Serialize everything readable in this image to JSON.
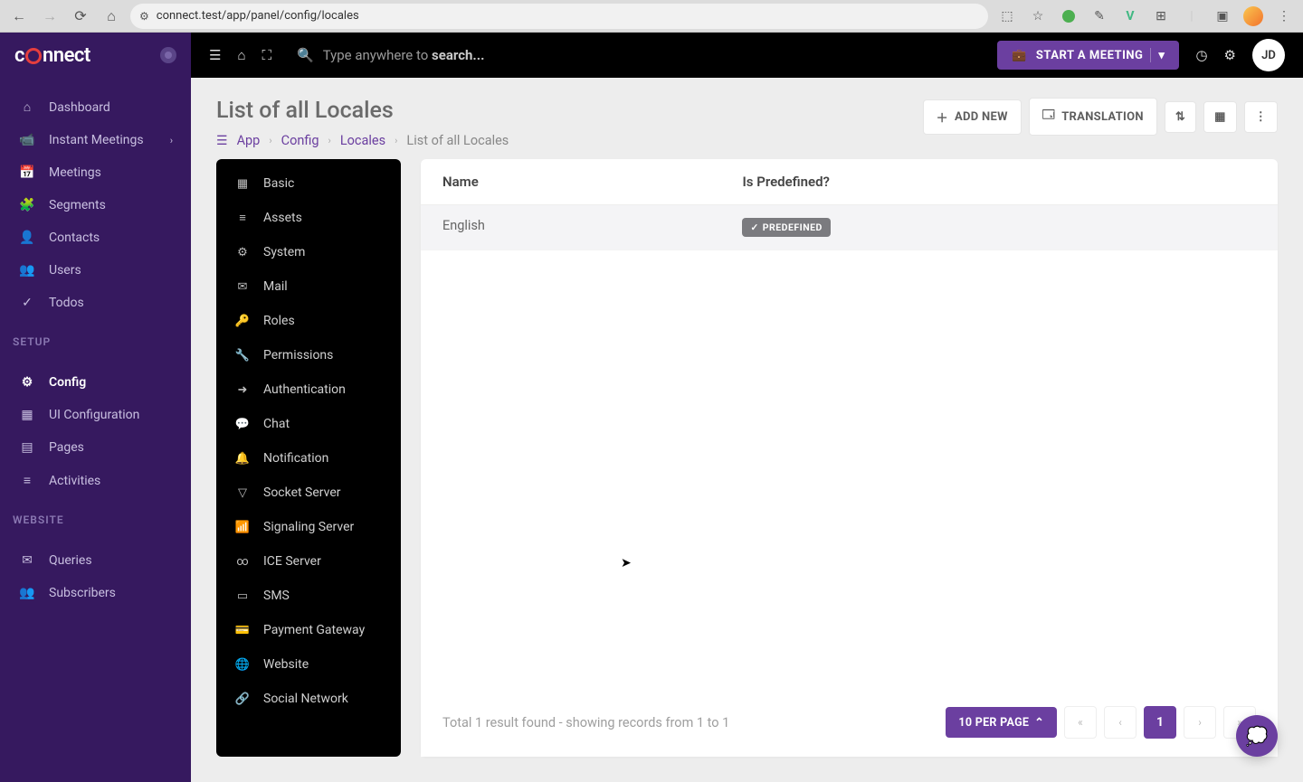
{
  "browser": {
    "url": "connect.test/app/panel/config/locales"
  },
  "brand": {
    "prefix": "c",
    "suffix": "nnect"
  },
  "topbar": {
    "search_placeholder_pre": "Type anywhere to ",
    "search_placeholder_bold": "search...",
    "meeting_btn": "START A MEETING",
    "avatar": "JD"
  },
  "sidebar": {
    "items": [
      {
        "label": "Dashboard",
        "icon": "⌂",
        "name": "dashboard"
      },
      {
        "label": "Instant Meetings",
        "icon": "📹",
        "name": "instant-meetings",
        "has_children": true
      },
      {
        "label": "Meetings",
        "icon": "📅",
        "name": "meetings"
      },
      {
        "label": "Segments",
        "icon": "🧩",
        "name": "segments"
      },
      {
        "label": "Contacts",
        "icon": "👤",
        "name": "contacts"
      },
      {
        "label": "Users",
        "icon": "👥",
        "name": "users"
      },
      {
        "label": "Todos",
        "icon": "✓",
        "name": "todos"
      }
    ],
    "section_setup": "SETUP",
    "setup_items": [
      {
        "label": "Config",
        "icon": "⚙",
        "name": "config",
        "active": true
      },
      {
        "label": "UI Configuration",
        "icon": "▦",
        "name": "ui-configuration"
      },
      {
        "label": "Pages",
        "icon": "▤",
        "name": "pages"
      },
      {
        "label": "Activities",
        "icon": "≡",
        "name": "activities"
      }
    ],
    "section_website": "WEBSITE",
    "website_items": [
      {
        "label": "Queries",
        "icon": "✉",
        "name": "queries"
      },
      {
        "label": "Subscribers",
        "icon": "👥",
        "name": "subscribers"
      }
    ]
  },
  "page": {
    "title": "List of all Locales",
    "breadcrumbs": {
      "app": "App",
      "config": "Config",
      "locales": "Locales",
      "current": "List of all Locales"
    },
    "actions": {
      "add_new": "ADD NEW",
      "translation": "TRANSLATION"
    }
  },
  "config_nav": [
    {
      "label": "Basic",
      "icon": "▦",
      "name": "basic"
    },
    {
      "label": "Assets",
      "icon": "≡",
      "name": "assets"
    },
    {
      "label": "System",
      "icon": "⚙",
      "name": "system"
    },
    {
      "label": "Mail",
      "icon": "✉",
      "name": "mail"
    },
    {
      "label": "Roles",
      "icon": "🔑",
      "name": "roles"
    },
    {
      "label": "Permissions",
      "icon": "🔧",
      "name": "permissions"
    },
    {
      "label": "Authentication",
      "icon": "➜",
      "name": "authentication"
    },
    {
      "label": "Chat",
      "icon": "💬",
      "name": "chat"
    },
    {
      "label": "Notification",
      "icon": "🔔",
      "name": "notification"
    },
    {
      "label": "Socket Server",
      "icon": "▽",
      "name": "socket-server"
    },
    {
      "label": "Signaling Server",
      "icon": "📶",
      "name": "signaling-server"
    },
    {
      "label": "ICE Server",
      "icon": "∞",
      "name": "ice-server"
    },
    {
      "label": "SMS",
      "icon": "▭",
      "name": "sms"
    },
    {
      "label": "Payment Gateway",
      "icon": "💳",
      "name": "payment-gateway"
    },
    {
      "label": "Website",
      "icon": "🌐",
      "name": "website"
    },
    {
      "label": "Social Network",
      "icon": "🔗",
      "name": "social-network"
    }
  ],
  "table": {
    "headers": {
      "name": "Name",
      "predefined": "Is Predefined?"
    },
    "rows": [
      {
        "name": "English",
        "predefined": true,
        "badge": "PREDEFINED"
      }
    ],
    "footer_text": "Total 1 result found - showing records from 1 to 1",
    "per_page": "10 PER PAGE",
    "current_page": "1"
  }
}
